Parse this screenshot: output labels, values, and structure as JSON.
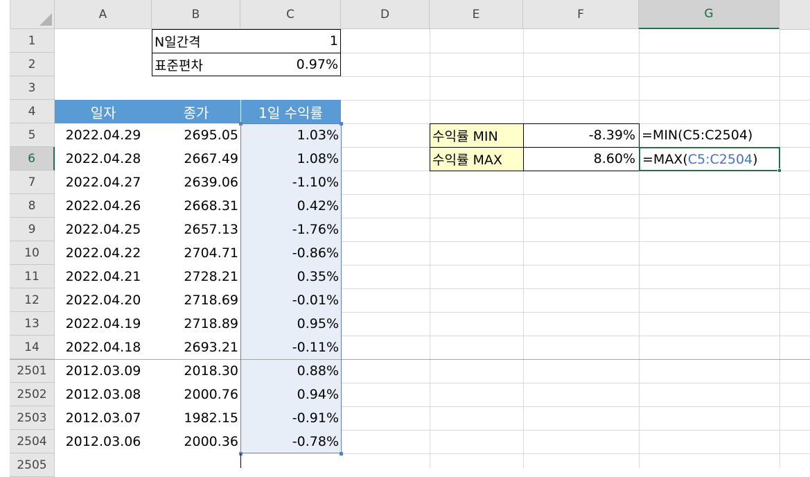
{
  "columns": [
    "A",
    "B",
    "C",
    "D",
    "E",
    "F",
    "G"
  ],
  "row_numbers": [
    "1",
    "2",
    "3",
    "4",
    "5",
    "6",
    "7",
    "8",
    "9",
    "10",
    "11",
    "12",
    "13",
    "14",
    "2501",
    "2502",
    "2503",
    "2504",
    "2505"
  ],
  "params": {
    "n_label": "N일간격",
    "n_value": "1",
    "sd_label": "표준편차",
    "sd_value": "0.97%"
  },
  "table": {
    "headers": [
      "일자",
      "종가",
      "1일 수익률"
    ],
    "rows": [
      [
        "2022.04.29",
        "2695.05",
        "1.03%"
      ],
      [
        "2022.04.28",
        "2667.49",
        "1.08%"
      ],
      [
        "2022.04.27",
        "2639.06",
        "-1.10%"
      ],
      [
        "2022.04.26",
        "2668.31",
        "0.42%"
      ],
      [
        "2022.04.25",
        "2657.13",
        "-1.76%"
      ],
      [
        "2022.04.22",
        "2704.71",
        "-0.86%"
      ],
      [
        "2022.04.21",
        "2728.21",
        "0.35%"
      ],
      [
        "2022.04.20",
        "2718.69",
        "-0.01%"
      ],
      [
        "2022.04.19",
        "2718.89",
        "0.95%"
      ],
      [
        "2022.04.18",
        "2693.21",
        "-0.11%"
      ],
      [
        "2012.03.09",
        "2018.30",
        "0.88%"
      ],
      [
        "2012.03.08",
        "2000.76",
        "0.94%"
      ],
      [
        "2012.03.07",
        "1982.15",
        "-0.91%"
      ],
      [
        "2012.03.06",
        "2000.36",
        "-0.78%"
      ]
    ]
  },
  "stats": {
    "min_label": "수익률 MIN",
    "min_value": "-8.39%",
    "min_formula": "=MIN(C5:C2504)",
    "max_label": "수익률 MAX",
    "max_value": "8.60%",
    "max_formula_pre": "=MAX(",
    "max_formula_ref": "C5:C2504",
    "max_formula_post": ")"
  },
  "colors": {
    "header_fill": "#5b9bd5",
    "label_fill": "#ffffcc",
    "selection_shade": "#e8eef8",
    "active_border": "#217346",
    "formula_ref": "#4472c4"
  }
}
